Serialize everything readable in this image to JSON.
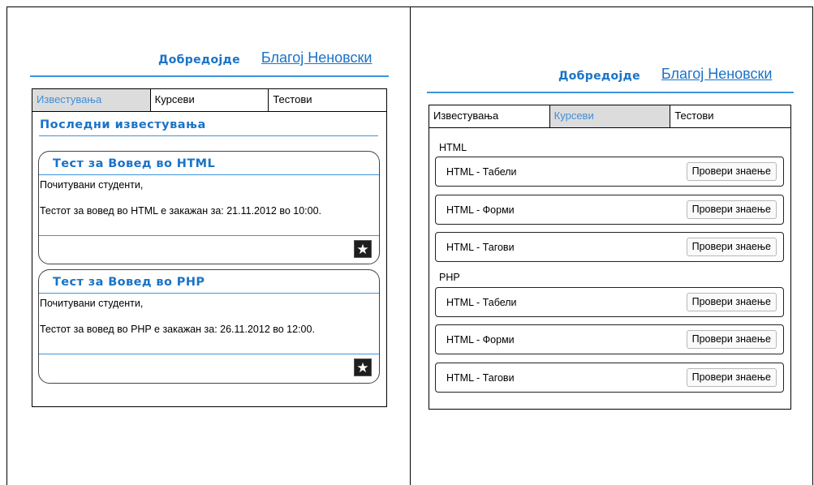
{
  "left": {
    "header": {
      "welcome": "Добредојде",
      "user": "Благој Неновски"
    },
    "tabs": [
      {
        "label": "Известувања"
      },
      {
        "label": "Курсеви"
      },
      {
        "label": "Тестови"
      }
    ],
    "section_title": "Последни известувања",
    "notices": [
      {
        "title": "Тест за Вовед во HTML",
        "greeting": "Почитувани студенти,",
        "text": "Тестот за вовед во HTML е закажан за: 21.11.2012 во 10:00.",
        "star": "★"
      },
      {
        "title": "Тест за Вовед во PHP",
        "greeting": "Почитувани студенти,",
        "text": "Тестот за вовед во PHP е закажан за: 26.11.2012 во 12:00.",
        "star": "★"
      }
    ]
  },
  "right": {
    "header": {
      "welcome": "Добредојде",
      "user": "Благој Неновски"
    },
    "tabs": [
      {
        "label": "Известувања"
      },
      {
        "label": "Курсеви"
      },
      {
        "label": "Тестови"
      }
    ],
    "groups": [
      {
        "name": "HTML",
        "courses": [
          {
            "name": "HTML - Табели",
            "button": "Провери знаење"
          },
          {
            "name": "HTML - Форми",
            "button": "Провери знаење"
          },
          {
            "name": "HTML - Тагови",
            "button": "Провери знаење"
          }
        ]
      },
      {
        "name": "PHP",
        "courses": [
          {
            "name": "HTML - Табели",
            "button": "Провери знаење"
          },
          {
            "name": "HTML - Форми",
            "button": "Провери знаење"
          },
          {
            "name": "HTML - Тагови",
            "button": "Провери знаење"
          }
        ]
      }
    ]
  },
  "colors": {
    "accent": "#1a73c7",
    "rule": "#3f94de",
    "active_tab_bg": "#dcdcdc"
  },
  "icons": {
    "star": "star-icon"
  }
}
